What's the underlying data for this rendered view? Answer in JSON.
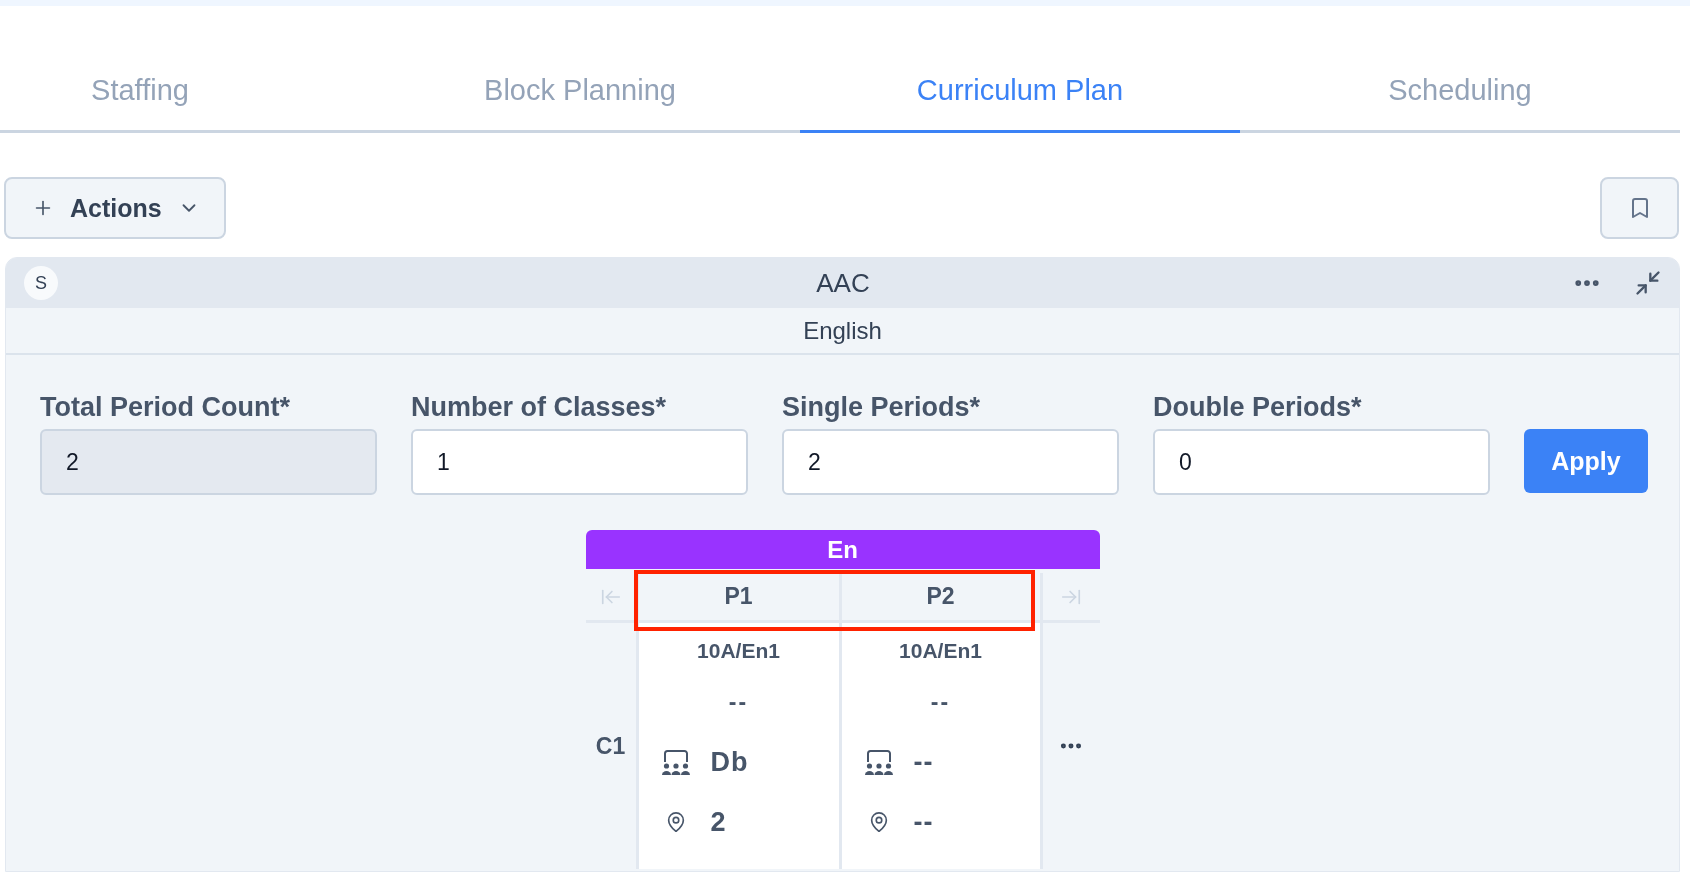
{
  "tabs": [
    {
      "label": "Staffing",
      "selected": false
    },
    {
      "label": "Block Planning",
      "selected": false
    },
    {
      "label": "Curriculum Plan",
      "selected": true
    },
    {
      "label": "Scheduling",
      "selected": false
    }
  ],
  "toolbar": {
    "actions_label": "Actions"
  },
  "panel": {
    "avatar": "S",
    "title": "AAC",
    "subtitle": "English",
    "fields": [
      {
        "label": "Total Period Count*",
        "value": "2",
        "disabled": true
      },
      {
        "label": "Number of Classes*",
        "value": "1",
        "disabled": false
      },
      {
        "label": "Single Periods*",
        "value": "2",
        "disabled": false
      },
      {
        "label": "Double Periods*",
        "value": "0",
        "disabled": false
      }
    ],
    "apply_label": "Apply",
    "grid": {
      "subject": "En",
      "period_header": {
        "highlighted": true,
        "periods": [
          "P1",
          "P2"
        ]
      },
      "rows": [
        {
          "label": "C1",
          "cells": [
            {
              "code": "10A/En1",
              "line_2": "--",
              "classroom": "Db",
              "location": "2"
            },
            {
              "code": "10A/En1",
              "line_2": "--",
              "classroom": "--",
              "location": "--"
            }
          ]
        }
      ]
    }
  }
}
